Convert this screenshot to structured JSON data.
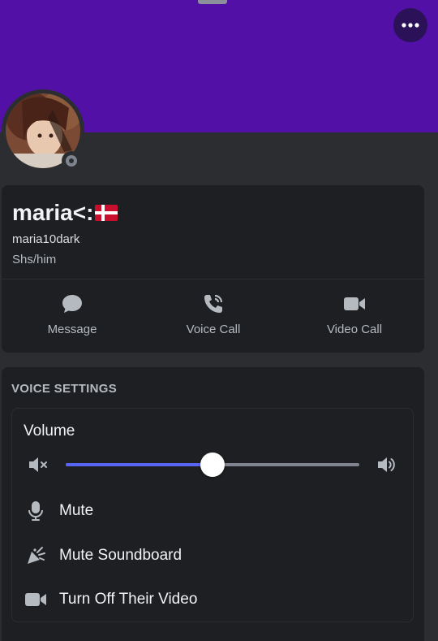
{
  "profile": {
    "display_name": "maria<:",
    "username": "maria10dark",
    "pronouns": "Shs/him",
    "status": "offline",
    "banner_color": "#5210a7"
  },
  "actions": [
    {
      "label": "Message",
      "icon": "chat-bubble-icon"
    },
    {
      "label": "Voice Call",
      "icon": "phone-icon"
    },
    {
      "label": "Video Call",
      "icon": "video-camera-icon"
    }
  ],
  "voice_settings": {
    "title": "VOICE SETTINGS",
    "volume_label": "Volume",
    "volume_value_percent": 50,
    "accent_color": "#5865f2",
    "options": [
      {
        "label": "Mute",
        "icon": "microphone-icon"
      },
      {
        "label": "Mute Soundboard",
        "icon": "soundboard-icon"
      },
      {
        "label": "Turn Off Their Video",
        "icon": "video-camera-icon"
      }
    ]
  }
}
